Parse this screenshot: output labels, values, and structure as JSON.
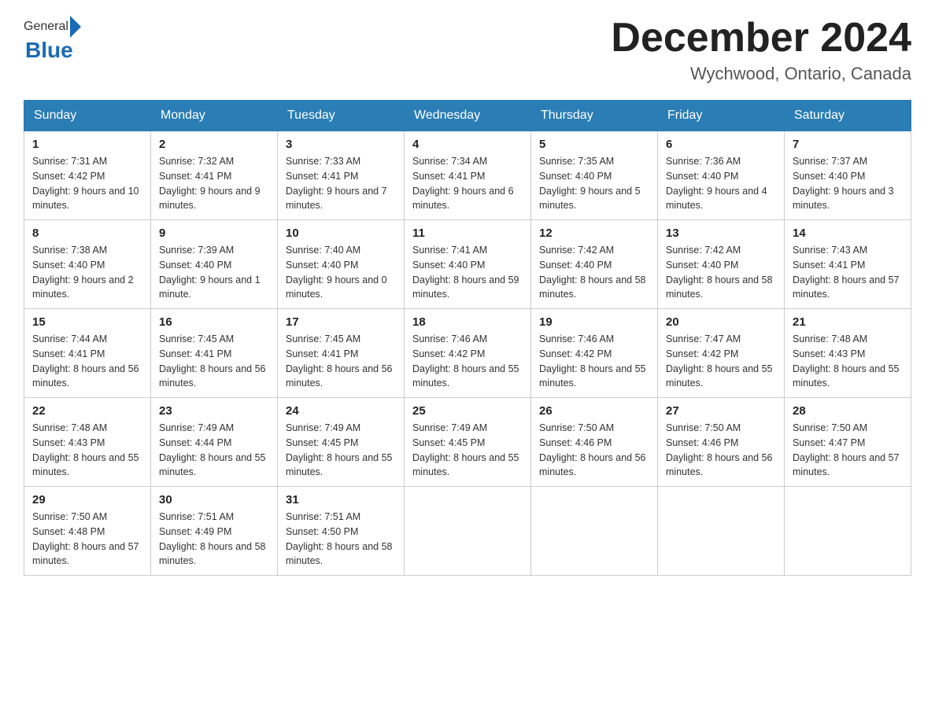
{
  "header": {
    "logo_general": "General",
    "logo_blue": "Blue",
    "title": "December 2024",
    "location": "Wychwood, Ontario, Canada"
  },
  "days_of_week": [
    "Sunday",
    "Monday",
    "Tuesday",
    "Wednesday",
    "Thursday",
    "Friday",
    "Saturday"
  ],
  "weeks": [
    [
      {
        "day": "1",
        "sunrise": "7:31 AM",
        "sunset": "4:42 PM",
        "daylight": "9 hours and 10 minutes."
      },
      {
        "day": "2",
        "sunrise": "7:32 AM",
        "sunset": "4:41 PM",
        "daylight": "9 hours and 9 minutes."
      },
      {
        "day": "3",
        "sunrise": "7:33 AM",
        "sunset": "4:41 PM",
        "daylight": "9 hours and 7 minutes."
      },
      {
        "day": "4",
        "sunrise": "7:34 AM",
        "sunset": "4:41 PM",
        "daylight": "9 hours and 6 minutes."
      },
      {
        "day": "5",
        "sunrise": "7:35 AM",
        "sunset": "4:40 PM",
        "daylight": "9 hours and 5 minutes."
      },
      {
        "day": "6",
        "sunrise": "7:36 AM",
        "sunset": "4:40 PM",
        "daylight": "9 hours and 4 minutes."
      },
      {
        "day": "7",
        "sunrise": "7:37 AM",
        "sunset": "4:40 PM",
        "daylight": "9 hours and 3 minutes."
      }
    ],
    [
      {
        "day": "8",
        "sunrise": "7:38 AM",
        "sunset": "4:40 PM",
        "daylight": "9 hours and 2 minutes."
      },
      {
        "day": "9",
        "sunrise": "7:39 AM",
        "sunset": "4:40 PM",
        "daylight": "9 hours and 1 minute."
      },
      {
        "day": "10",
        "sunrise": "7:40 AM",
        "sunset": "4:40 PM",
        "daylight": "9 hours and 0 minutes."
      },
      {
        "day": "11",
        "sunrise": "7:41 AM",
        "sunset": "4:40 PM",
        "daylight": "8 hours and 59 minutes."
      },
      {
        "day": "12",
        "sunrise": "7:42 AM",
        "sunset": "4:40 PM",
        "daylight": "8 hours and 58 minutes."
      },
      {
        "day": "13",
        "sunrise": "7:42 AM",
        "sunset": "4:40 PM",
        "daylight": "8 hours and 58 minutes."
      },
      {
        "day": "14",
        "sunrise": "7:43 AM",
        "sunset": "4:41 PM",
        "daylight": "8 hours and 57 minutes."
      }
    ],
    [
      {
        "day": "15",
        "sunrise": "7:44 AM",
        "sunset": "4:41 PM",
        "daylight": "8 hours and 56 minutes."
      },
      {
        "day": "16",
        "sunrise": "7:45 AM",
        "sunset": "4:41 PM",
        "daylight": "8 hours and 56 minutes."
      },
      {
        "day": "17",
        "sunrise": "7:45 AM",
        "sunset": "4:41 PM",
        "daylight": "8 hours and 56 minutes."
      },
      {
        "day": "18",
        "sunrise": "7:46 AM",
        "sunset": "4:42 PM",
        "daylight": "8 hours and 55 minutes."
      },
      {
        "day": "19",
        "sunrise": "7:46 AM",
        "sunset": "4:42 PM",
        "daylight": "8 hours and 55 minutes."
      },
      {
        "day": "20",
        "sunrise": "7:47 AM",
        "sunset": "4:42 PM",
        "daylight": "8 hours and 55 minutes."
      },
      {
        "day": "21",
        "sunrise": "7:48 AM",
        "sunset": "4:43 PM",
        "daylight": "8 hours and 55 minutes."
      }
    ],
    [
      {
        "day": "22",
        "sunrise": "7:48 AM",
        "sunset": "4:43 PM",
        "daylight": "8 hours and 55 minutes."
      },
      {
        "day": "23",
        "sunrise": "7:49 AM",
        "sunset": "4:44 PM",
        "daylight": "8 hours and 55 minutes."
      },
      {
        "day": "24",
        "sunrise": "7:49 AM",
        "sunset": "4:45 PM",
        "daylight": "8 hours and 55 minutes."
      },
      {
        "day": "25",
        "sunrise": "7:49 AM",
        "sunset": "4:45 PM",
        "daylight": "8 hours and 55 minutes."
      },
      {
        "day": "26",
        "sunrise": "7:50 AM",
        "sunset": "4:46 PM",
        "daylight": "8 hours and 56 minutes."
      },
      {
        "day": "27",
        "sunrise": "7:50 AM",
        "sunset": "4:46 PM",
        "daylight": "8 hours and 56 minutes."
      },
      {
        "day": "28",
        "sunrise": "7:50 AM",
        "sunset": "4:47 PM",
        "daylight": "8 hours and 57 minutes."
      }
    ],
    [
      {
        "day": "29",
        "sunrise": "7:50 AM",
        "sunset": "4:48 PM",
        "daylight": "8 hours and 57 minutes."
      },
      {
        "day": "30",
        "sunrise": "7:51 AM",
        "sunset": "4:49 PM",
        "daylight": "8 hours and 58 minutes."
      },
      {
        "day": "31",
        "sunrise": "7:51 AM",
        "sunset": "4:50 PM",
        "daylight": "8 hours and 58 minutes."
      },
      null,
      null,
      null,
      null
    ]
  ],
  "labels": {
    "sunrise": "Sunrise:",
    "sunset": "Sunset:",
    "daylight": "Daylight:"
  }
}
